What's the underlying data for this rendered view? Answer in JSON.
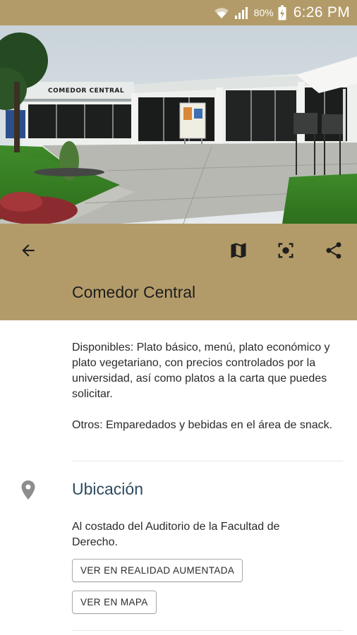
{
  "status_bar": {
    "battery_percent": "80%",
    "time": "6:26 PM",
    "icons": [
      "wifi-icon",
      "signal-icon",
      "battery-charging-icon"
    ]
  },
  "hero": {
    "sign_text": "COMEDOR CENTRAL"
  },
  "app_bar": {
    "title": "Comedor Central",
    "icons": [
      "back-arrow-icon",
      "map-icon",
      "augmented-reality-icon",
      "share-icon"
    ],
    "color": "#b39b69"
  },
  "description": {
    "paragraph1": "Disponibles: Plato básico, menú, plato económico y plato vegetariano, con precios controlados por la universidad, así como platos a la carta que puedes solicitar.",
    "paragraph2": "Otros: Emparedados y bebidas en el área de snack."
  },
  "location": {
    "icon": "location-pin-icon",
    "title": "Ubicación",
    "text": "Al costado del Auditorio de la Facultad de Derecho.",
    "ar_button_label": "VER EN REALIDAD AUMENTADA",
    "map_button_label": "VER EN MAPA"
  }
}
